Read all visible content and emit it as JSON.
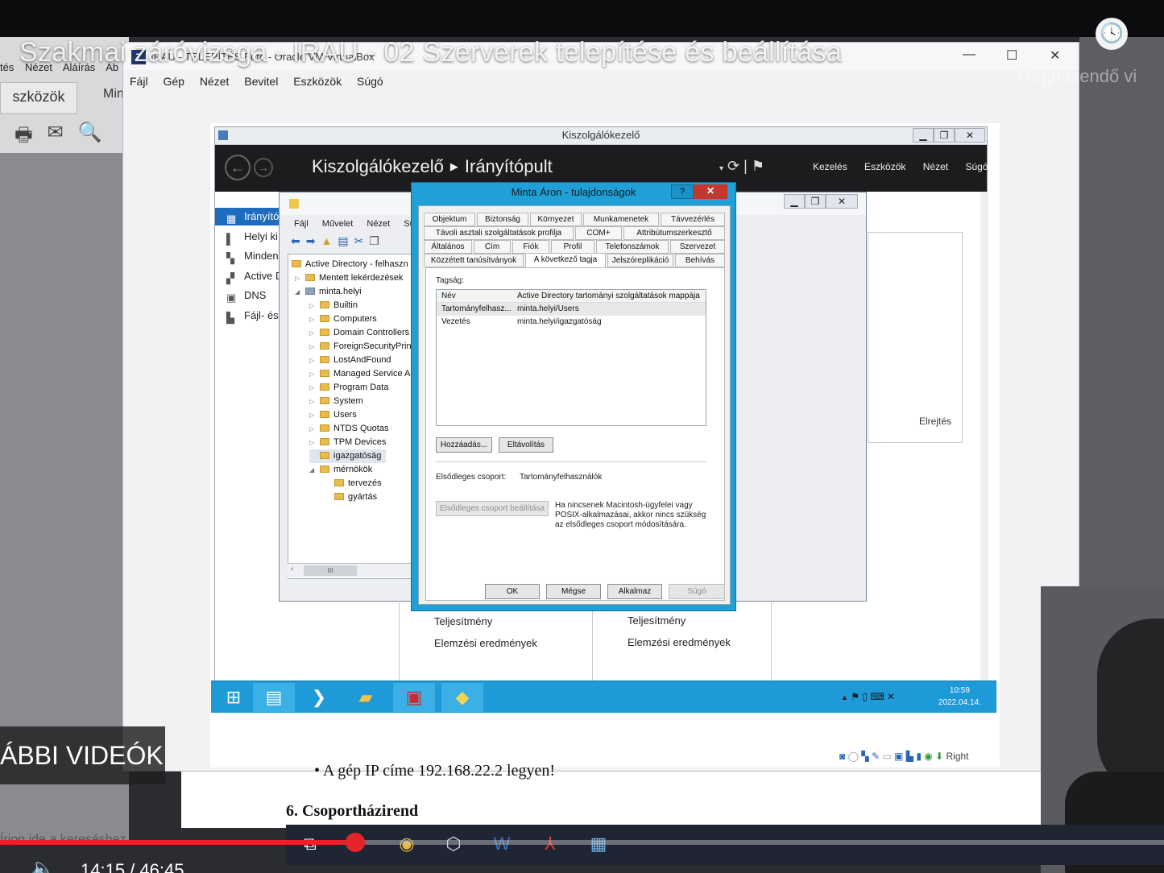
{
  "youtube": {
    "video_title": "Szakmai záróvizsga - IRAU - 02 Szerverek telepítése és beállítása",
    "watch_later": "Megnézendő vi",
    "more_videos": "ÁBBI VIDEÓK",
    "current_time": "14:15 / 46:45",
    "progress_fraction": 0.305,
    "search_hint": "Írjon ide a kereséshez"
  },
  "background_doc": {
    "menu": [
      "tés",
      "Nézet",
      "Aláírás",
      "Ab"
    ],
    "tab": "szközök",
    "tab2": "Min",
    "line": "•   A gép IP címe 192.168.22.2 legyen!",
    "heading": "6. Csoportházirend"
  },
  "vbox": {
    "title": "IRAU - TELEPÍTÉS Futó - Oracle VM VirtualBox",
    "menu": [
      "Fájl",
      "Gép",
      "Nézet",
      "Bevitel",
      "Eszközök",
      "Súgó"
    ],
    "status_right": "Right"
  },
  "server_manager": {
    "window_title": "Kiszolgálókezelő",
    "breadcrumb_root": "Kiszolgálókezelő",
    "breadcrumb_current": "Irányítópult",
    "menu": [
      "Kezelés",
      "Eszközök",
      "Nézet",
      "Súgó"
    ],
    "nav": [
      "Irányító",
      "Helyi ki",
      "Minden",
      "Active D",
      "DNS",
      "Fájl- és"
    ],
    "hide": "Elrejtés",
    "tiles": [
      {
        "perf": "Teljesítmény",
        "bpa": "Elemzési eredmények"
      },
      {
        "perf": "Teljesítmény",
        "bpa": "Elemzési eredmények"
      }
    ]
  },
  "aduc": {
    "menu": [
      "Fájl",
      "Művelet",
      "Nézet",
      "Súg"
    ],
    "tree": [
      {
        "label": "Active Directory - felhaszn",
        "level": 0,
        "expander": ""
      },
      {
        "label": "Mentett lekérdezések",
        "level": 1,
        "expander": "▷"
      },
      {
        "label": "minta.helyi",
        "level": 1,
        "expander": "◢"
      },
      {
        "label": "Builtin",
        "level": 2,
        "expander": "▷"
      },
      {
        "label": "Computers",
        "level": 2,
        "expander": "▷"
      },
      {
        "label": "Domain Controllers",
        "level": 2,
        "expander": "▷"
      },
      {
        "label": "ForeignSecurityPrincipals",
        "level": 2,
        "expander": "▷"
      },
      {
        "label": "LostAndFound",
        "level": 2,
        "expander": "▷"
      },
      {
        "label": "Managed Service Accounts",
        "level": 2,
        "expander": "▷"
      },
      {
        "label": "Program Data",
        "level": 2,
        "expander": "▷"
      },
      {
        "label": "System",
        "level": 2,
        "expander": "▷"
      },
      {
        "label": "Users",
        "level": 2,
        "expander": "▷"
      },
      {
        "label": "NTDS Quotas",
        "level": 2,
        "expander": "▷"
      },
      {
        "label": "TPM Devices",
        "level": 2,
        "expander": "▷"
      },
      {
        "label": "igazgatóság",
        "level": 2,
        "expander": "",
        "selected": true
      },
      {
        "label": "mérnökök",
        "level": 2,
        "expander": "◢"
      },
      {
        "label": "tervezés",
        "level": 3,
        "expander": ""
      },
      {
        "label": "gyártás",
        "level": 3,
        "expander": ""
      }
    ],
    "scroll_label": "III"
  },
  "dialog": {
    "title": "Minta Áron - tulajdonságok",
    "help": "?",
    "close": "✕",
    "tabs_row1": [
      "Objektum",
      "Biztonság",
      "Környezet",
      "Munkamenetek",
      "Távvezérlés"
    ],
    "tabs_row2": [
      "Távoli asztali szolgáltatások profilja",
      "COM+",
      "Attribútumszerkesztő"
    ],
    "tabs_row3": [
      "Általános",
      "Cím",
      "Fiók",
      "Profil",
      "Telefonszámok",
      "Szervezet"
    ],
    "tabs_row4": [
      "Közzétett tanúsítványok",
      "A következő tagja",
      "Jelszóreplikáció",
      "Behívás"
    ],
    "membership_label": "Tagság:",
    "columns": [
      "Név",
      "Active Directory tartományi szolgáltatások mappája"
    ],
    "members": [
      {
        "name": "Tartományfelhasz...",
        "folder": "minta.helyi/Users"
      },
      {
        "name": "Vezetés",
        "folder": "minta.helyi/igazgatóság"
      }
    ],
    "add": "Hozzáadás...",
    "remove": "Eltávolítás",
    "primary_group_label": "Elsődleges csoport:",
    "primary_group_value": "Tartományfelhasználók",
    "set_primary": "Elsődleges csoport beállítása",
    "note": "Ha nincsenek Macintosh-ügyfelei vagy POSIX-alkalmazásai, akkor nincs szükség az elsődleges csoport módosítására.",
    "ok": "OK",
    "cancel": "Mégse",
    "apply": "Alkalmaz",
    "help_btn": "Súgó"
  },
  "guest_taskbar": {
    "time": "10:59",
    "date": "2022.04.14."
  }
}
